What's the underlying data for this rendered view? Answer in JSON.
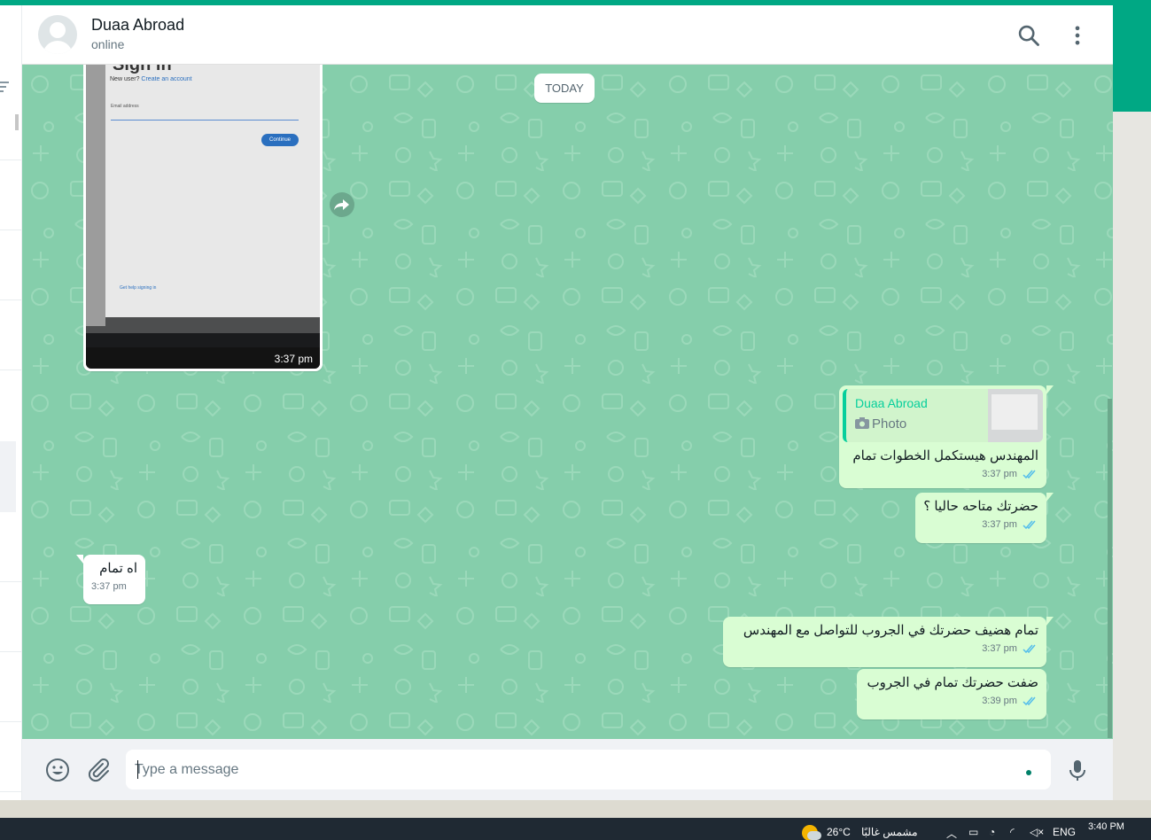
{
  "colors": {
    "accent": "#00a884",
    "chat_background": "#85ceab",
    "outgoing_bubble": "#d9fdd3",
    "incoming_bubble": "#ffffff",
    "read_ticks": "#53bdeb"
  },
  "header": {
    "contact_name": "Duaa Abroad",
    "contact_status": "online",
    "icons": [
      "avatar-placeholder-icon",
      "search-icon",
      "more-vertical-icon"
    ]
  },
  "date_divider": "TODAY",
  "image_message": {
    "direction": "incoming",
    "time": "3:37 pm",
    "photo_text": {
      "title": "Sign in",
      "new_user": "New user?",
      "create_account": "Create an account",
      "email_label": "Email address",
      "continue_button": "Continue",
      "help_link": "Get help signing in"
    },
    "forward_icon": "forward-icon"
  },
  "reply_message": {
    "direction": "outgoing",
    "quoted_name": "Duaa Abroad",
    "quoted_type": "Photo",
    "quoted_icon": "camera-icon",
    "text": "المهندس هيستكمل الخطوات تمام",
    "time": "3:37 pm",
    "status": "read"
  },
  "messages": [
    {
      "direction": "outgoing",
      "text": "حضرتك متاحه حاليا ؟",
      "time": "3:37 pm",
      "status": "read"
    },
    {
      "direction": "incoming",
      "text": "اه تمام",
      "time": "3:37 pm"
    },
    {
      "direction": "outgoing",
      "text": "تمام هضيف حضرتك في الجروب للتواصل مع المهندس",
      "time": "3:37 pm",
      "status": "read"
    },
    {
      "direction": "outgoing",
      "text": "ضفت حضرتك تمام في الجروب",
      "time": "3:39 pm",
      "status": "read"
    }
  ],
  "composer": {
    "placeholder": "Type a message",
    "icons": [
      "emoji-icon",
      "attach-icon",
      "microphone-icon"
    ]
  },
  "taskbar": {
    "temperature": "26°C",
    "weather_text": "مشمس غالبًا",
    "language": "ENG",
    "time": "3:40 PM"
  }
}
